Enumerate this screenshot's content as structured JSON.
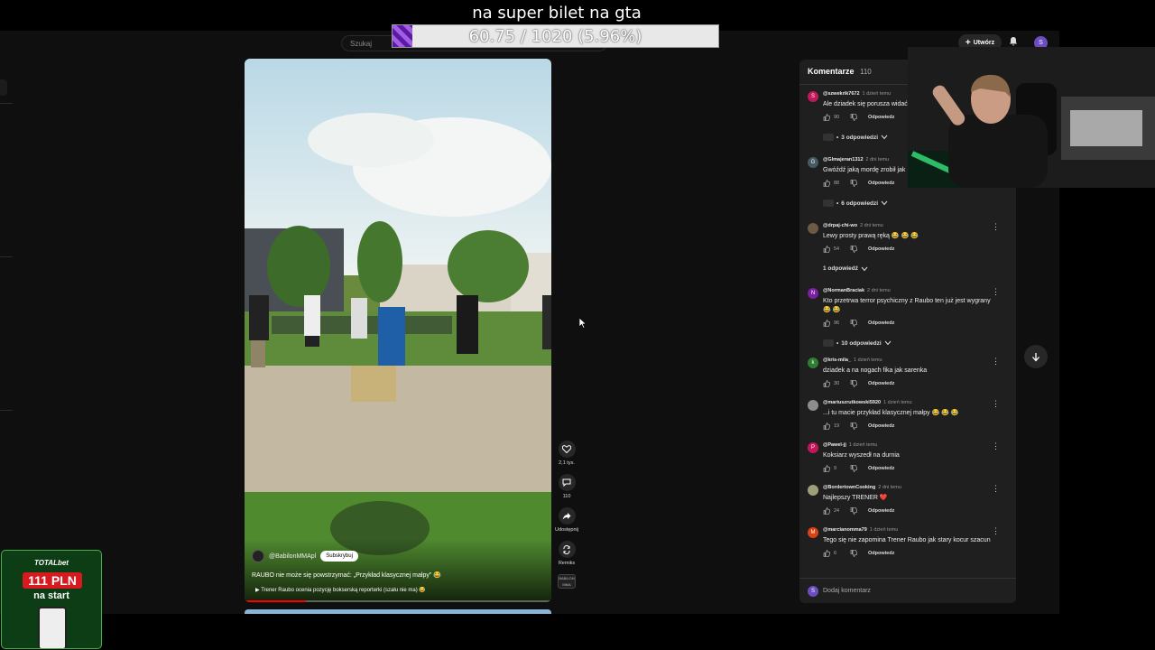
{
  "youtube": {
    "search_placeholder": "Szukaj",
    "create_label": "Utwórz",
    "user_initial": "S"
  },
  "video": {
    "channel": "@BabilonMMApl",
    "subscribe_label": "Subskrybuj",
    "title": "RAUBO nie może się powstrzymać: „Przykład klasycznej małpy” 😂",
    "related_link": "Trener Raubo ocenia pozycję bokserską reporterki (szału nie ma) 😂",
    "progress_fraction": 0.2
  },
  "actions": {
    "likes": "2,1 tys.",
    "comments": "110",
    "share": "Udostępnij",
    "remix": "Remiks",
    "thumb_text": "BABILON MMA"
  },
  "comments": {
    "title": "Komentarze",
    "count": "110",
    "add_placeholder": "Dodaj komentarz",
    "reply_label": "Odpowiedz",
    "items": [
      {
        "author": "@szwekrik7672",
        "time": "1 dzień temu",
        "text": "Ale dziadek się porusza widać",
        "likes": "90",
        "replies": "3 odpowiedzi",
        "avatar": "S",
        "color": "#c2185b"
      },
      {
        "author": "@Glmajeran1312",
        "time": "2 dni temu",
        "text": "Gwóźdź jaką mordę zrobił jak",
        "likes": "88",
        "replies": "6 odpowiedzi",
        "avatar": "G",
        "color": "#455a64"
      },
      {
        "author": "@drpaj-chi-wo",
        "time": "2 dni temu",
        "text": "Lewy prosty prawą ręką 😂 😂 😂",
        "likes": "54",
        "replies": "1 odpowiedź",
        "avatar": "",
        "color": "#6d5a43"
      },
      {
        "author": "@NormanBraciak",
        "time": "2 dni temu",
        "text": "Kto przetrwa terror psychiczny z Raubo ten już jest wygrany 😂 😂",
        "likes": "96",
        "replies": "10 odpowiedzi",
        "avatar": "N",
        "color": "#7b1fa2"
      },
      {
        "author": "@kris-mila_",
        "time": "1 dzień temu",
        "text": "dziadek a na nogach fika jak sarenka",
        "likes": "30",
        "replies": "",
        "avatar": "k",
        "color": "#2e7d32"
      },
      {
        "author": "@mariuszrutkowski5920",
        "time": "1 dzień temu",
        "text": "...i tu macie przykład klasycznej małpy 😂 😂 😂",
        "likes": "19",
        "replies": "",
        "avatar": "",
        "color": "#8d8d8d"
      },
      {
        "author": "@Pawel-jj",
        "time": "1 dzień temu",
        "text": "Koksiarz wyszedł na durnia",
        "likes": "9",
        "replies": "",
        "avatar": "P",
        "color": "#c2185b"
      },
      {
        "author": "@BordertownCooking",
        "time": "2 dni temu",
        "text": "Najlepszy TRENER ❤️",
        "likes": "24",
        "replies": "",
        "avatar": "",
        "color": "#9e9e7a"
      },
      {
        "author": "@marcianomma79",
        "time": "1 dzień temu",
        "text": "Tego się nie zapomina Trener  Raubo  jak stary kocur szacun",
        "likes": "6",
        "replies": "",
        "avatar": "M",
        "color": "#d84315"
      }
    ]
  },
  "stream": {
    "goal_title": "na super bilet na gta",
    "goal_progress_text": "60.75 / 1020 (5.96%)",
    "goal_fraction": 0.0596
  },
  "ad": {
    "brand": "TOTALbet",
    "amount": "111 PLN",
    "subtitle": "na start"
  }
}
